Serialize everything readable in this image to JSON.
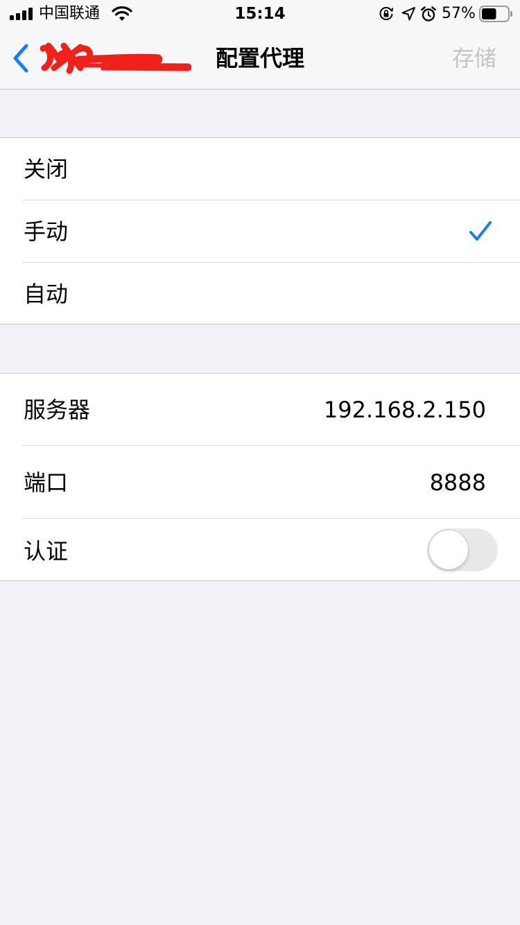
{
  "status_bar": {
    "carrier": "中国联通",
    "time": "15:14",
    "battery_percent": "57%",
    "battery_level": 0.57
  },
  "nav": {
    "title": "配置代理",
    "save_label": "存储",
    "back_label_redacted": true
  },
  "proxy_modes": [
    {
      "label": "关闭",
      "selected": false
    },
    {
      "label": "手动",
      "selected": true
    },
    {
      "label": "自动",
      "selected": false
    }
  ],
  "server": {
    "server_label": "服务器",
    "server_value": "192.168.2.150",
    "port_label": "端口",
    "port_value": "8888",
    "auth_label": "认证",
    "auth_enabled": false
  },
  "colors": {
    "accent": "#1A7CF5",
    "redaction": "#F0211A",
    "background": "#F2F1F7",
    "disabled_text": "#C4C4C8"
  }
}
